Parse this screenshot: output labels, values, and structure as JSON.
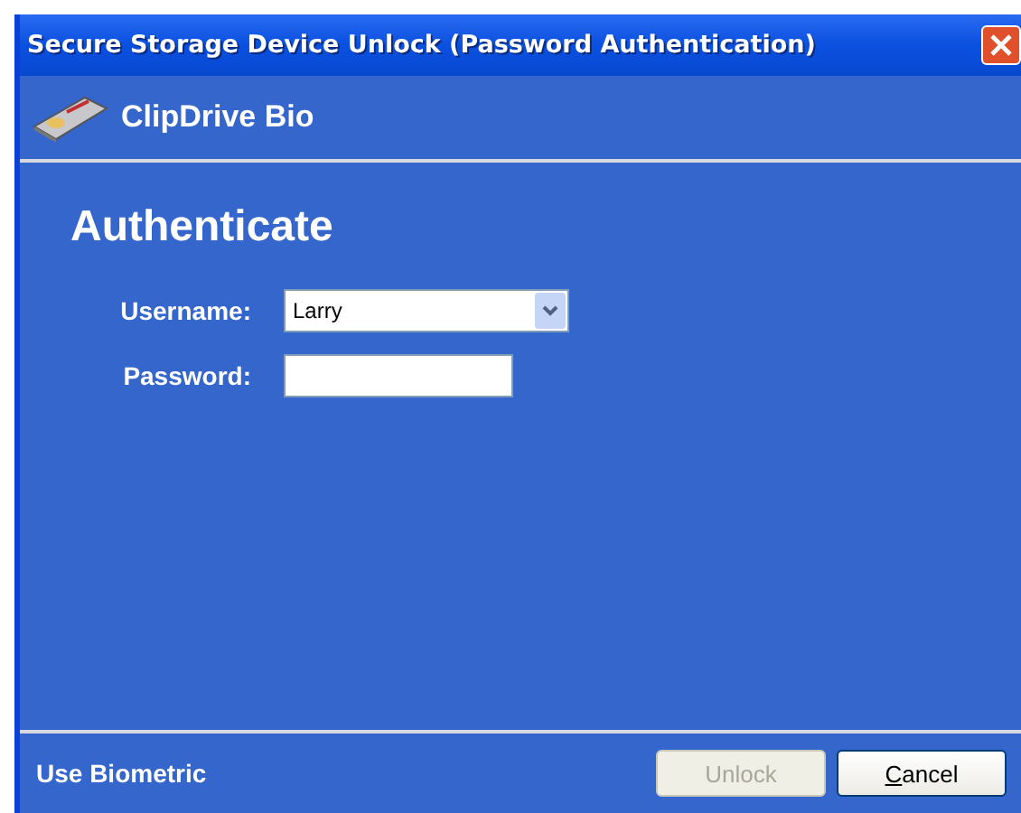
{
  "window": {
    "title": "Secure Storage Device Unlock (Password Authentication)"
  },
  "header": {
    "product": "ClipDrive Bio"
  },
  "heading": "Authenticate",
  "fields": [
    {
      "kind": "dropdown",
      "label": "Username:",
      "value": "Larry"
    },
    {
      "kind": "password",
      "label": "Password:"
    }
  ],
  "footer": {
    "link": "Use Biometric",
    "buttons": [
      {
        "label": "Unlock",
        "disabled": true
      },
      {
        "mnemonic": "C",
        "label": "ancel",
        "disabled": false
      }
    ]
  }
}
